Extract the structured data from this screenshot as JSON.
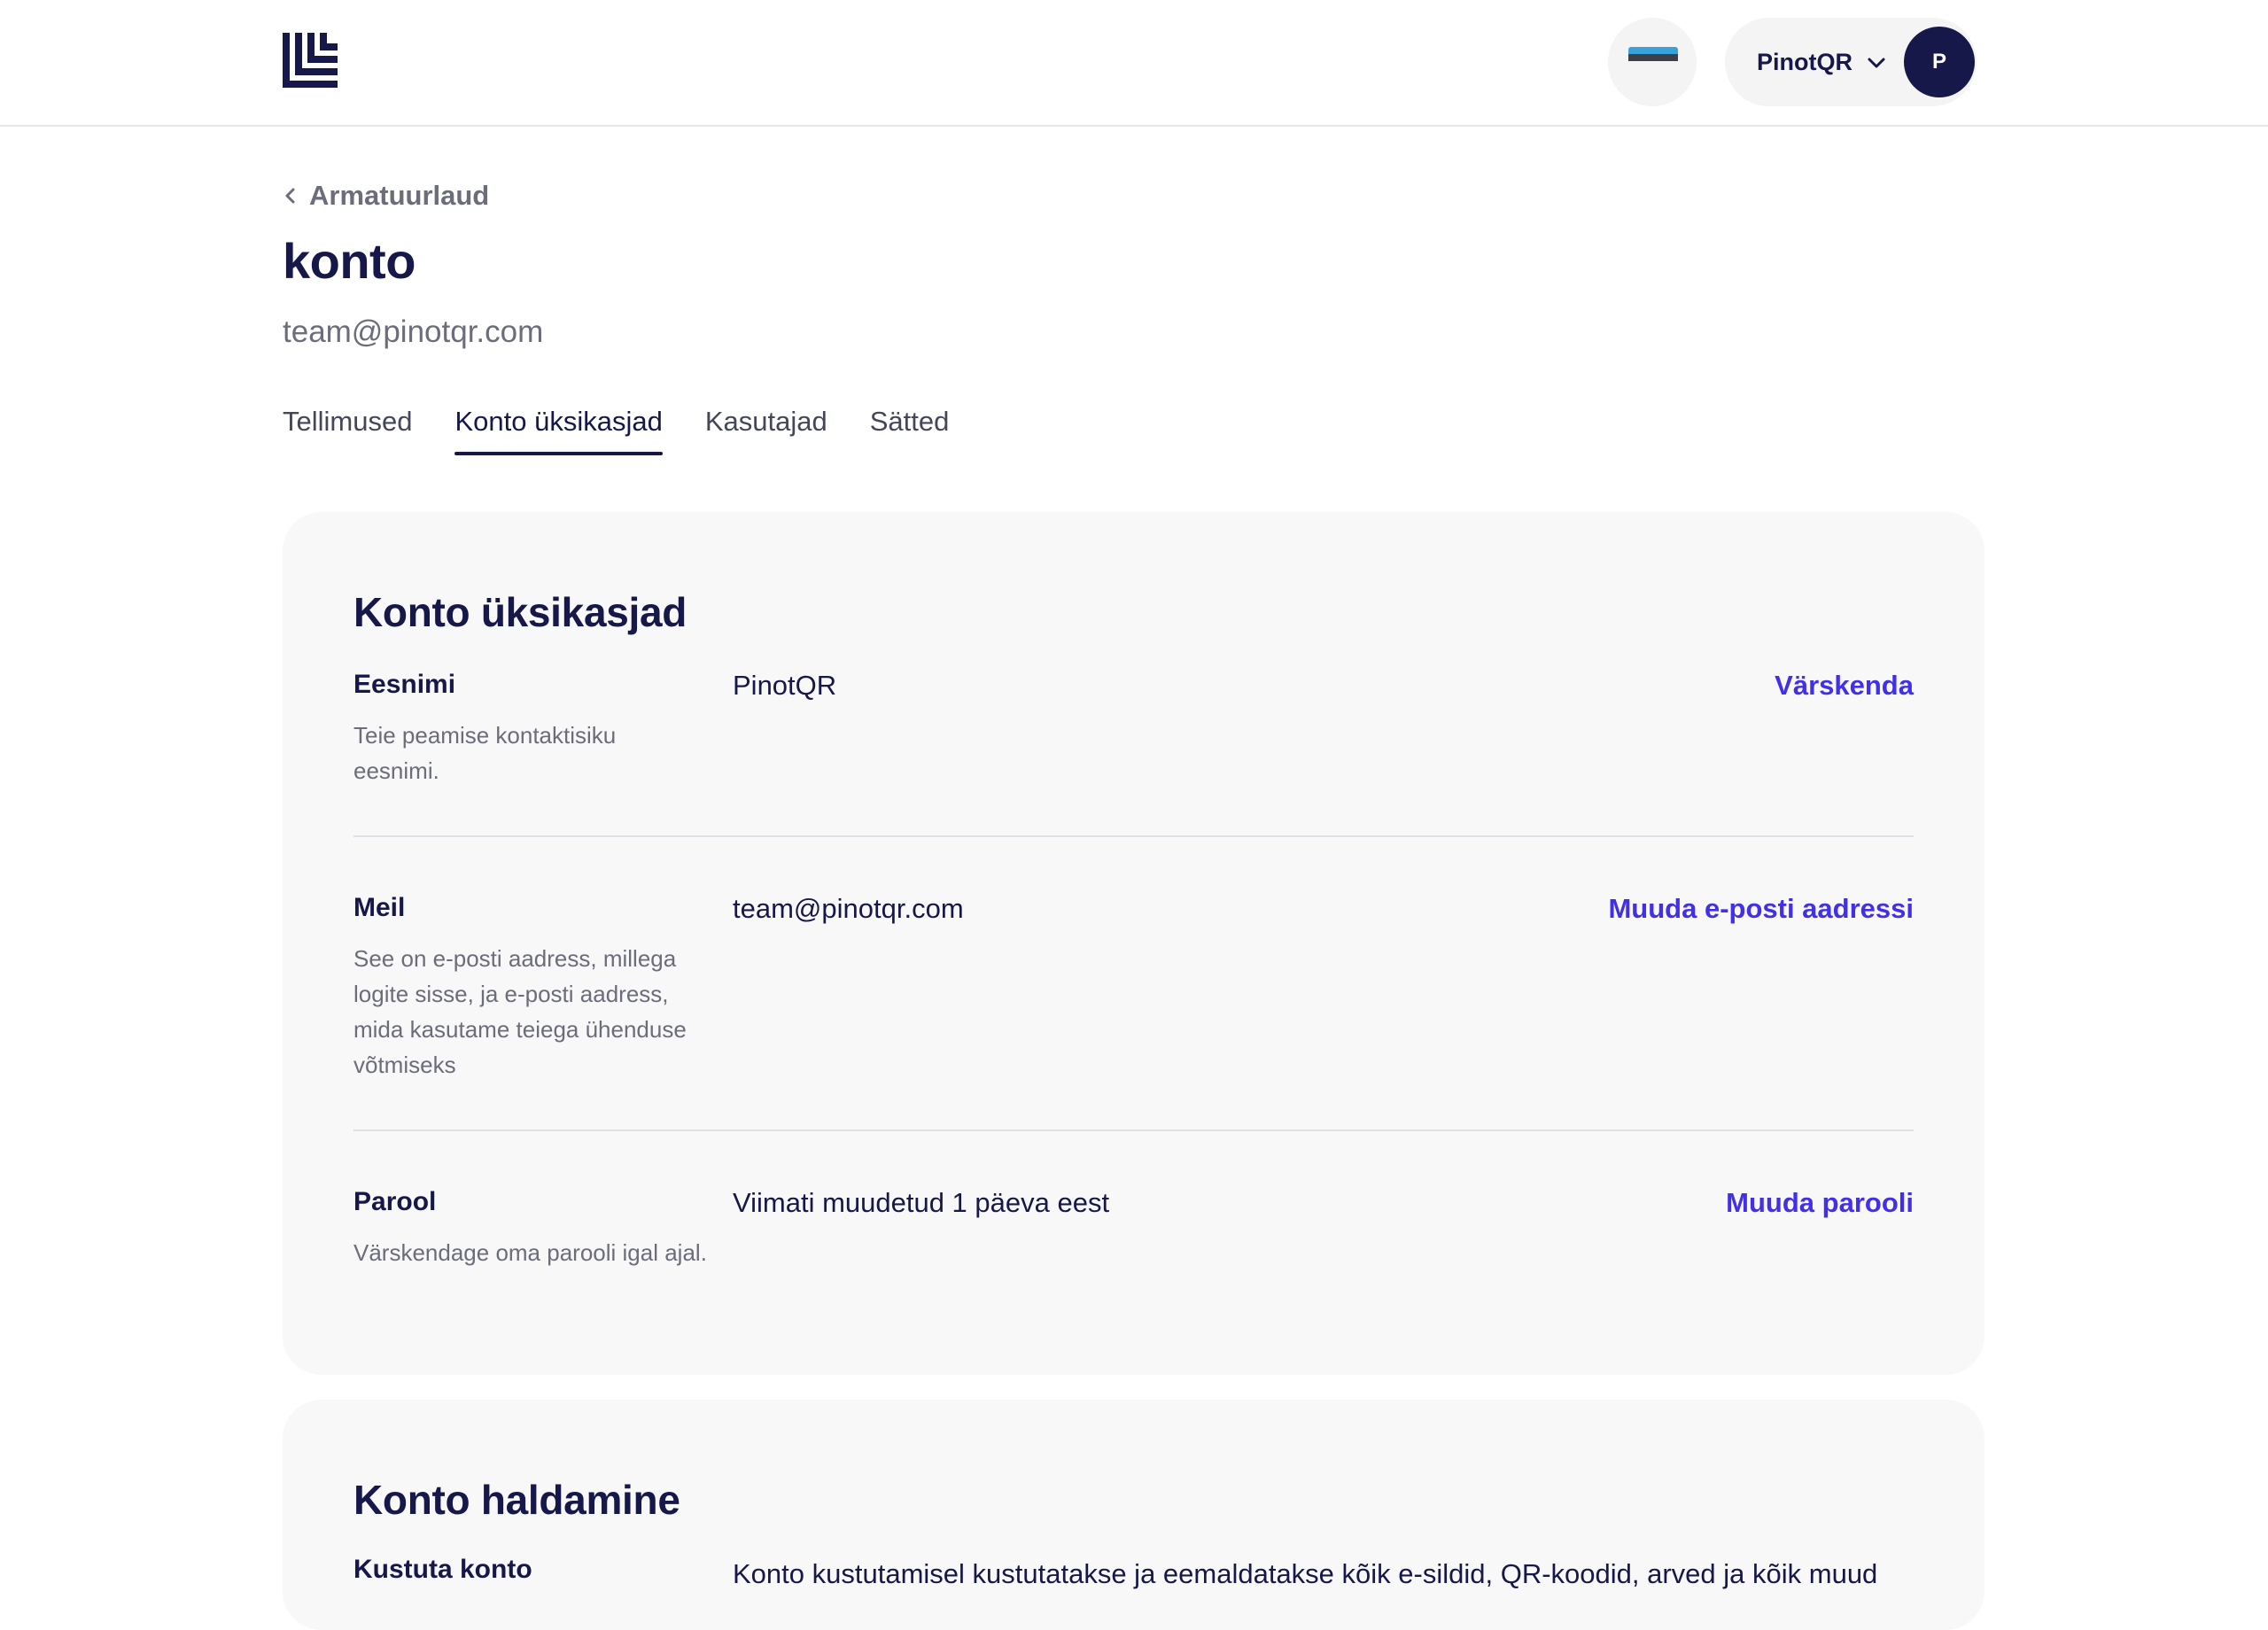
{
  "header": {
    "account_name": "PinotQR",
    "avatar_initial": "P",
    "language_flag": "estonian-flag",
    "colors": {
      "flag_blue": "#38a3db",
      "flag_black": "#3d4049",
      "flag_white": "#f4f4f5"
    }
  },
  "page": {
    "breadcrumb": "Armatuurlaud",
    "title": "konto",
    "email": "team@pinotqr.com"
  },
  "tabs": [
    {
      "label": "Tellimused"
    },
    {
      "label": "Konto üksikasjad",
      "active": true
    },
    {
      "label": "Kasutajad"
    },
    {
      "label": "Sätted"
    }
  ],
  "account_details": {
    "title": "Konto üksikasjad",
    "rows": [
      {
        "label": "Eesnimi",
        "description": "Teie peamise kontaktisiku eesnimi.",
        "value": "PinotQR",
        "action": "Värskenda"
      },
      {
        "label": "Meil",
        "description": "See on e-posti aadress, millega logite sisse, ja e-posti aadress, mida kasutame teiega ühenduse võtmiseks",
        "value": "team@pinotqr.com",
        "action": "Muuda e-posti aadressi"
      },
      {
        "label": "Parool",
        "description": "Värskendage oma parooli igal ajal.",
        "value": "Viimati muudetud 1 päeva eest",
        "action": "Muuda parooli"
      }
    ]
  },
  "account_management": {
    "title": "Konto haldamine",
    "delete_label": "Kustuta konto",
    "delete_text": "Konto kustutamisel kustutatakse ja eemaldatakse kõik e-sildid, QR-koodid, arved ja kõik muud"
  },
  "colors": {
    "primary": "#17184a",
    "link": "#4130e8",
    "muted": "#6b6d7a",
    "card_bg": "#f8f8f8"
  }
}
